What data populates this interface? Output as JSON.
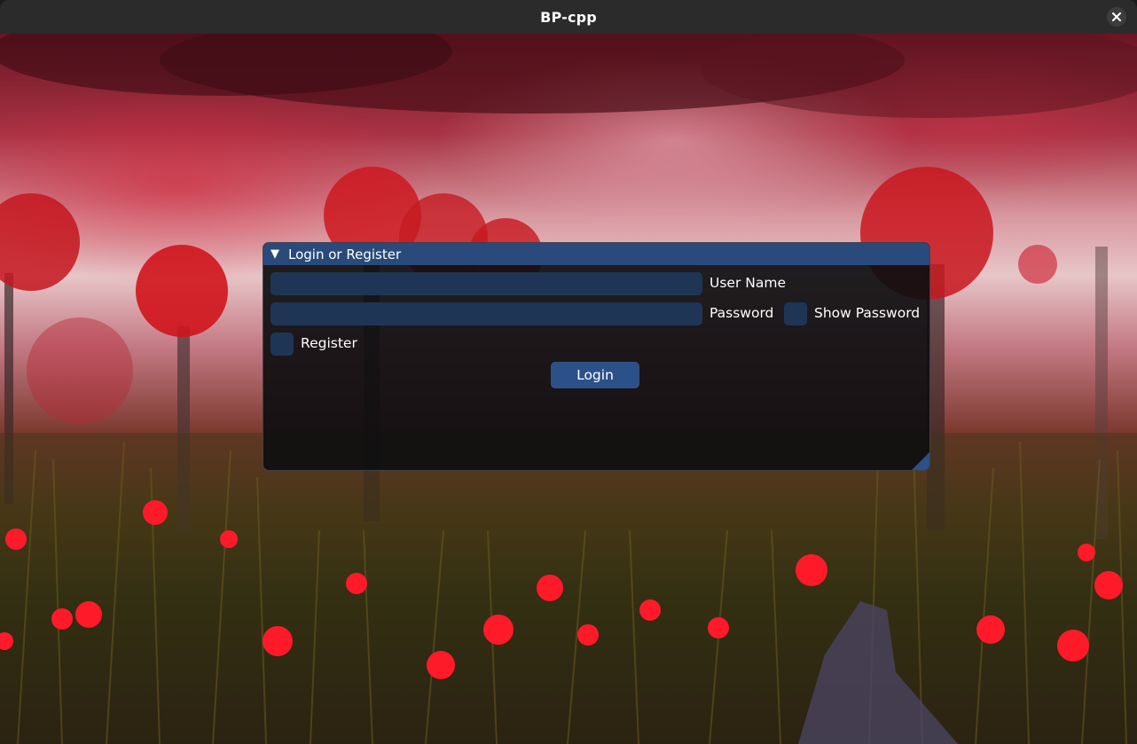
{
  "window": {
    "title": "BP-cpp",
    "close_icon": "close-icon"
  },
  "panel": {
    "title": "Login or Register",
    "collapse_icon": "triangle-down-icon",
    "username": {
      "value": "",
      "label": "User Name"
    },
    "password": {
      "value": "",
      "label": "Password"
    },
    "show_password": {
      "label": "Show Password",
      "checked": false
    },
    "register": {
      "label": "Register",
      "checked": false
    },
    "login_button": "Login"
  },
  "colors": {
    "header": "#294a7a",
    "field": "#1f3556",
    "button": "#2c5188"
  }
}
